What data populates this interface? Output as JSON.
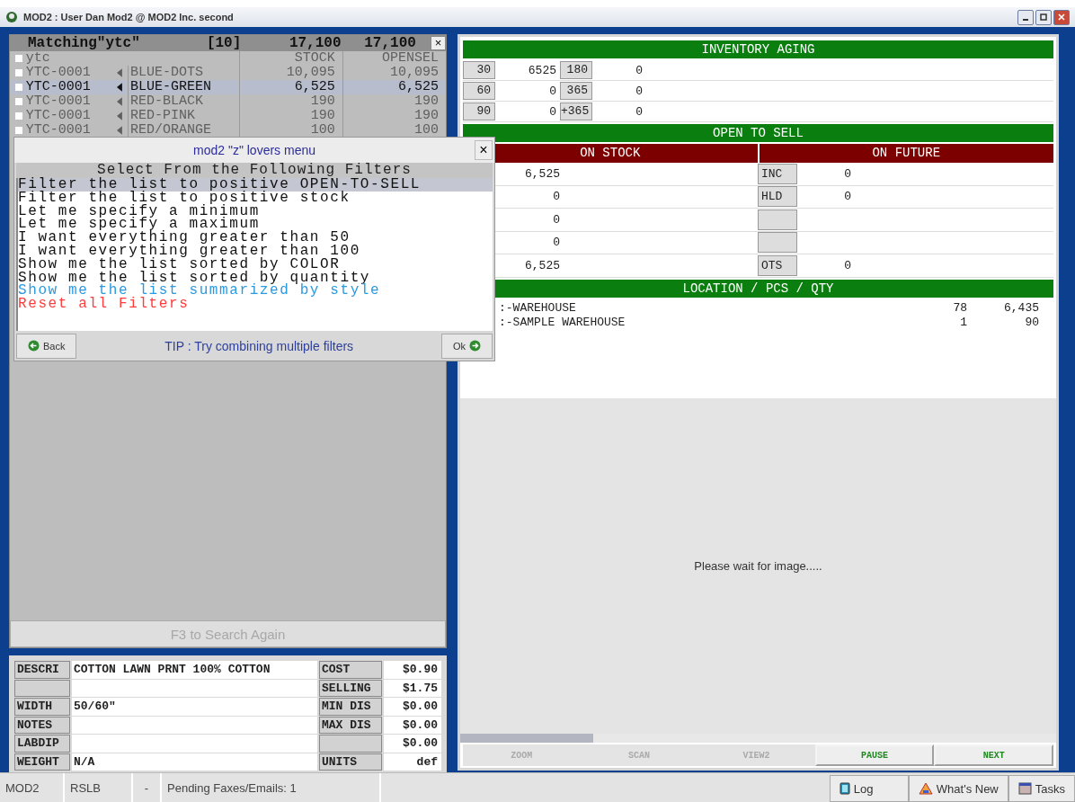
{
  "window": {
    "title": "MOD2 : User Dan Mod2 @ MOD2 Inc. second"
  },
  "search_list": {
    "title": "Matching\"ytc\"",
    "count": "[10]",
    "total_stock": "17,100",
    "total_opensel": "17,100",
    "close": "×",
    "columns": [
      "ytc",
      "STOCK",
      "OPENSEL"
    ],
    "header_checked": false,
    "rows": [
      {
        "style": "YTC-0001",
        "variant": "BLUE-DOTS",
        "stock": "10,095",
        "opensel": "10,095",
        "checked": false,
        "selected": false
      },
      {
        "style": "YTC-0001",
        "variant": "BLUE-GREEN",
        "stock": "6,525",
        "opensel": "6,525",
        "checked": false,
        "selected": true
      },
      {
        "style": "YTC-0001",
        "variant": "RED-BLACK",
        "stock": "190",
        "opensel": "190",
        "checked": false,
        "selected": false
      },
      {
        "style": "YTC-0001",
        "variant": "RED-PINK",
        "stock": "190",
        "opensel": "190",
        "checked": false,
        "selected": false
      },
      {
        "style": "YTC-0001",
        "variant": "RED/ORANGE",
        "stock": "100",
        "opensel": "100",
        "checked": false,
        "selected": false
      }
    ],
    "search_again": "F3 to Search Again"
  },
  "filter_menu": {
    "title": "mod2 \"z\" lovers menu",
    "close": "×",
    "heading": "Select From the Following Filters",
    "options": [
      {
        "label": "Filter the list to positive OPEN-TO-SELL",
        "kind": "filter",
        "selected": true
      },
      {
        "label": "Filter the list to positive stock",
        "kind": "filter",
        "selected": false
      },
      {
        "label": "Let me specify a minimum",
        "kind": "filter",
        "selected": false
      },
      {
        "label": "Let me specify a maximum",
        "kind": "filter",
        "selected": false
      },
      {
        "label": "I want everything greater than 50",
        "kind": "filter",
        "selected": false
      },
      {
        "label": "I want everything greater than 100",
        "kind": "filter",
        "selected": false
      },
      {
        "label": "Show me the list sorted by COLOR",
        "kind": "filter",
        "selected": false
      },
      {
        "label": "Show me the list sorted by quantity",
        "kind": "filter",
        "selected": false
      },
      {
        "label": "Show me the list summarized by style",
        "kind": "summary",
        "selected": false
      },
      {
        "label": "Reset all Filters",
        "kind": "reset",
        "selected": false
      }
    ],
    "back": "Back",
    "tip": "TIP : Try combining multiple filters",
    "ok": "Ok"
  },
  "item_details": {
    "rows": [
      {
        "label": "DESCRI",
        "value": "COTTON LAWN PRNT 100% COTTON",
        "price_label": "COST",
        "price": "$0.90"
      },
      {
        "price_label": "SELLING",
        "price": "$1.75"
      },
      {
        "label": "WIDTH",
        "value": "50/60\"",
        "price_label": "MIN DIS",
        "price": "$0.00"
      },
      {
        "label": "NOTES",
        "price_label": "MAX DIS",
        "price": "$0.00"
      },
      {
        "label": "LABDIP",
        "price": "$0.00"
      },
      {
        "label": "WEIGHT",
        "value": "N/A",
        "price_label": "UNITS",
        "price": "def"
      }
    ]
  },
  "inventory_aging": {
    "title": "INVENTORY AGING",
    "rows": [
      {
        "bucket": "30",
        "qty": "6525",
        "bucket_2": "180",
        "qty_2": "0"
      },
      {
        "bucket": "60",
        "qty": "0",
        "bucket_2": "365",
        "qty_2": "0"
      },
      {
        "bucket": "90",
        "qty": "0",
        "bucket_2": "+365",
        "qty_2": "0"
      }
    ]
  },
  "open_to_sell": {
    "title": "OPEN TO SELL",
    "on_stock_title": "ON STOCK",
    "on_future_title": "ON FUTURE",
    "rows": [
      {
        "stock": "6,525",
        "kind": "labeled",
        "label": "INC",
        "future": "0"
      },
      {
        "stock": "0",
        "kind": "labeled",
        "label": "HLD",
        "future": "0"
      },
      {
        "stock": "0",
        "kind": "blank"
      },
      {
        "stock": "0",
        "kind": "blank"
      },
      {
        "stock": "6,525",
        "kind": "labeled",
        "label": "OTS",
        "future": "0"
      }
    ]
  },
  "locations": {
    "title": "LOCATION / PCS / QTY",
    "rows": [
      {
        "name": ":-WAREHOUSE",
        "pcs": "78",
        "qty": "6,435"
      },
      {
        "name": ":-SAMPLE WAREHOUSE",
        "pcs": "1",
        "qty": "90"
      }
    ]
  },
  "image_viewer": {
    "message": "Please wait for image.....",
    "buttons": [
      {
        "label": "ZOOM",
        "disabled": true
      },
      {
        "label": "SCAN",
        "disabled": true
      },
      {
        "label": "VIEW2",
        "disabled": true
      },
      {
        "label": "PAUSE",
        "disabled": false
      },
      {
        "label": "NEXT",
        "disabled": false
      }
    ]
  },
  "status_bar": {
    "fields": [
      "MOD2",
      "RSLB",
      "-",
      "Pending Faxes/Emails: 1"
    ],
    "buttons": [
      "Log",
      "What's New",
      "Tasks"
    ]
  }
}
